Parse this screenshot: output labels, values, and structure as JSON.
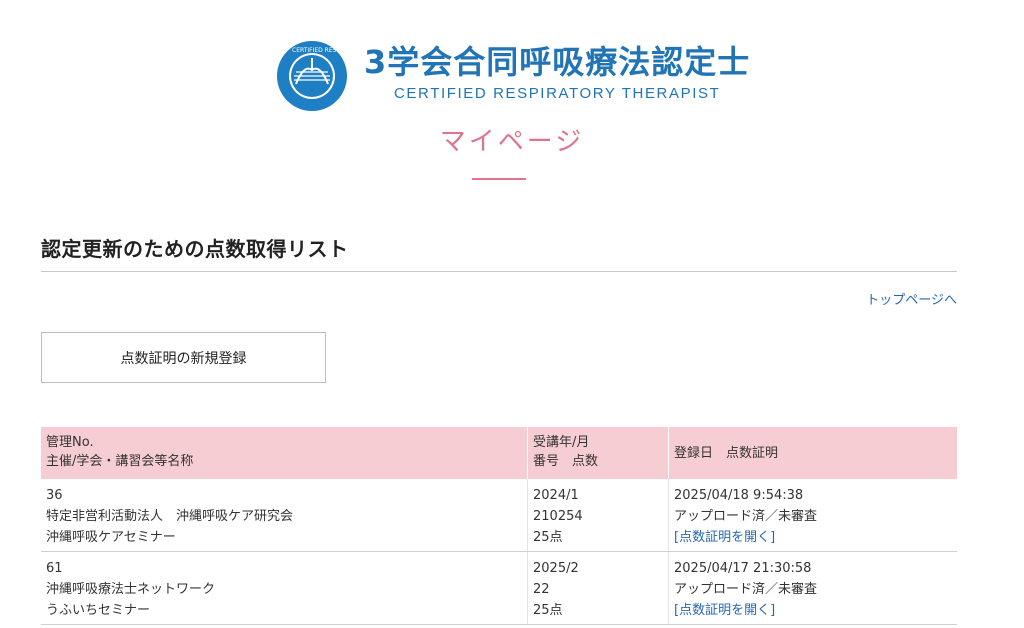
{
  "logo": {
    "title": "3学会合同呼吸療法認定士",
    "subtitle": "CERTIFIED RESPIRATORY THERAPIST",
    "seal_text": "CERTIFIED RESPIRATORY THERAPIST",
    "brand_color": "#2174b5"
  },
  "page": {
    "heading": "マイページ",
    "accent_color": "#e2738a"
  },
  "section": {
    "title": "認定更新のための点数取得リスト",
    "top_link": "トップページへ",
    "new_button": "点数証明の新規登録"
  },
  "table": {
    "header": {
      "col1_line1": "管理No.",
      "col1_line2": "主催/学会・講習会等名称",
      "col2_line1": "受講年/月",
      "col2_line2": "番号　点数",
      "col3": "登録日　点数証明"
    },
    "header_bg": "#f7cdd4",
    "rows": [
      {
        "no": "36",
        "organizer": "特定非営利活動法人　沖縄呼吸ケア研究会",
        "seminar": "沖縄呼吸ケアセミナー",
        "year_month": "2024/1",
        "number": "210254",
        "points": "25点",
        "registered": "2025/04/18 9:54:38",
        "status": "アップロード済／未審査",
        "cert_link": "[点数証明を開く]"
      },
      {
        "no": "61",
        "organizer": "沖縄呼吸療法士ネットワーク",
        "seminar": "うふいちセミナー",
        "year_month": "2025/2",
        "number": "22",
        "points": "25点",
        "registered": "2025/04/17 21:30:58",
        "status": "アップロード済／未審査",
        "cert_link": "[点数証明を開く]"
      }
    ]
  }
}
